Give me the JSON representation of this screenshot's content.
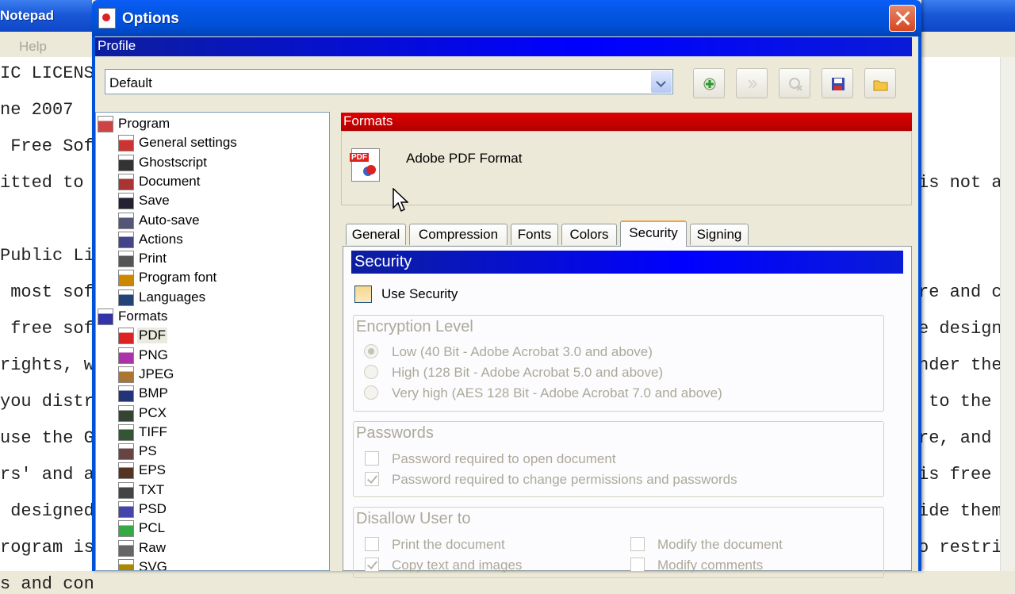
{
  "notepad": {
    "title": "Notepad",
    "menu": "Help",
    "left_lines": [
      "IC LICENS",
      "ne 2007",
      " Free Sof",
      "itted to",
      "",
      "Public Li",
      " most sof",
      " free sof",
      "rights, w",
      "you distr",
      "use the G",
      "rs' and a",
      " designed",
      "rogram is",
      "s and con"
    ],
    "right_lines": [
      "",
      "",
      "",
      "is not a",
      "",
      "",
      "re and ch",
      "e designe",
      "nder the",
      " to the r",
      "re, and (",
      "is free s",
      "ide them,",
      "o restric",
      ""
    ]
  },
  "dialog": {
    "title": "Options",
    "profile_label": "Profile",
    "profile_value": "Default",
    "toolbar": [
      "add-profile-icon",
      "rename-profile-icon",
      "delete-profile-icon",
      "save-profile-icon",
      "open-profile-icon"
    ],
    "tree": {
      "program": "Program",
      "program_items": [
        "General settings",
        "Ghostscript",
        "Document",
        "Save",
        "Auto-save",
        "Actions",
        "Print",
        "Program font",
        "Languages"
      ],
      "formats": "Formats",
      "format_items": [
        "PDF",
        "PNG",
        "JPEG",
        "BMP",
        "PCX",
        "TIFF",
        "PS",
        "EPS",
        "TXT",
        "PSD",
        "PCL",
        "Raw",
        "SVG"
      ],
      "selected": "PDF"
    },
    "formats_header": "Formats",
    "format_title": "Adobe PDF Format",
    "tabs": [
      "General",
      "Compression",
      "Fonts",
      "Colors",
      "Security",
      "Signing"
    ],
    "active_tab": "Security",
    "security": {
      "header": "Security",
      "use_security": "Use Security",
      "use_security_checked": false,
      "encryption_title": "Encryption Level",
      "encryption_options": [
        "Low (40 Bit - Adobe Acrobat 3.0 and above)",
        "High (128 Bit - Adobe Acrobat 5.0 and above)",
        "Very high (AES 128 Bit - Adobe Acrobat 7.0 and above)"
      ],
      "encryption_selected": 0,
      "passwords_title": "Passwords",
      "password_open": "Password required to open document",
      "password_open_checked": false,
      "password_change": "Password required to change permissions and passwords",
      "password_change_checked": true,
      "disallow_title": "Disallow User to",
      "disallow_left": [
        "Print the document",
        "Copy text and images"
      ],
      "disallow_left_checked": [
        false,
        true
      ],
      "disallow_right": [
        "Modify the document",
        "Modify comments"
      ],
      "disallow_right_checked": [
        false,
        false
      ]
    }
  },
  "colors": {
    "title_blue": "#0050d8",
    "profile_bar": "#0000ff",
    "formats_bar": "#cc0000",
    "disabled_text": "#aca899"
  }
}
